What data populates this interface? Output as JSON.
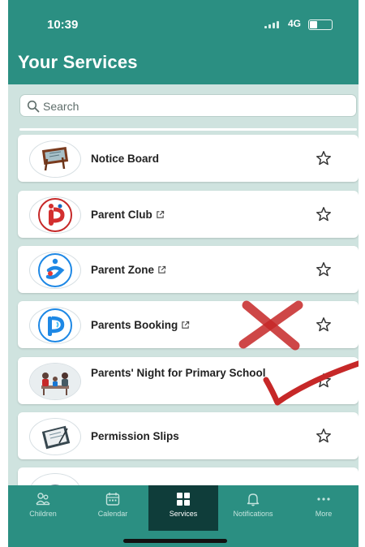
{
  "status_bar": {
    "time": "10:39",
    "network": "4G"
  },
  "header": {
    "title": "Your Services"
  },
  "search": {
    "placeholder": "Search"
  },
  "services": [
    {
      "label": "Notice Board",
      "external": false,
      "icon": "notice-board-icon"
    },
    {
      "label": "Parent Club",
      "external": true,
      "icon": "parent-club-icon"
    },
    {
      "label": "Parent Zone",
      "external": true,
      "icon": "parent-zone-icon"
    },
    {
      "label": "Parents Booking",
      "external": true,
      "icon": "parents-booking-icon"
    },
    {
      "label": "Parents' Night for Primary School",
      "external": false,
      "icon": "parents-night-icon"
    },
    {
      "label": "Permission Slips",
      "external": false,
      "icon": "permission-slips-icon"
    }
  ],
  "nav": [
    {
      "label": "Children",
      "icon": "children-icon",
      "active": false
    },
    {
      "label": "Calendar",
      "icon": "calendar-icon",
      "active": false
    },
    {
      "label": "Services",
      "icon": "services-icon",
      "active": true
    },
    {
      "label": "Notifications",
      "icon": "bell-icon",
      "active": false
    },
    {
      "label": "More",
      "icon": "more-icon",
      "active": false
    }
  ],
  "colors": {
    "primary": "#2b8f82",
    "active_nav": "#0f3d3a",
    "list_background": "#cfe3df",
    "annotation_red": "#c62828"
  }
}
